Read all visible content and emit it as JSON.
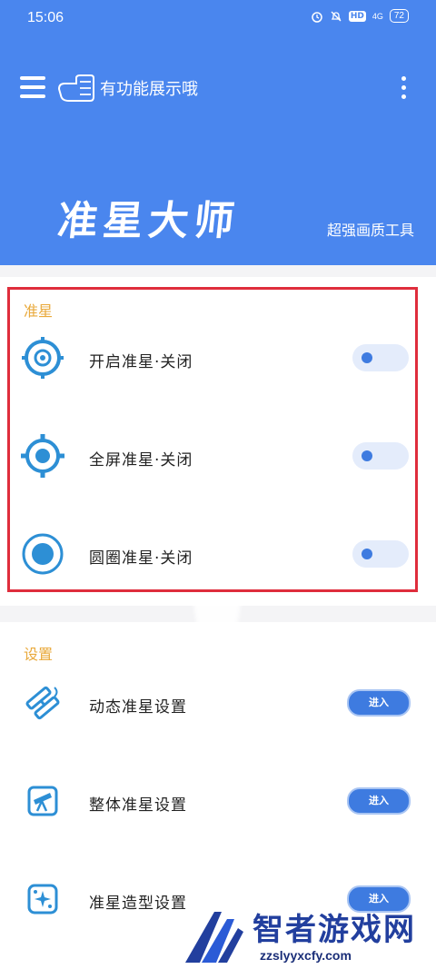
{
  "status_bar": {
    "time": "15:06",
    "network": "4G",
    "hd": "HD",
    "battery": "72"
  },
  "toolbar": {
    "title": "有功能展示哦"
  },
  "header": {
    "app_title": "准星大师",
    "subtitle": "超强画质工具"
  },
  "section_crosshair": {
    "title": "准星",
    "rows": [
      {
        "label": "开启准星·关闭",
        "icon": "crosshair-ring-icon",
        "toggle_on": false
      },
      {
        "label": "全屏准星·关闭",
        "icon": "crosshair-dot-icon",
        "toggle_on": false
      },
      {
        "label": "圆圈准星·关闭",
        "icon": "circle-target-icon",
        "toggle_on": false
      }
    ]
  },
  "section_settings": {
    "title": "设置",
    "rows": [
      {
        "label": "动态准星设置",
        "icon": "satellite-icon",
        "button": "进入"
      },
      {
        "label": "整体准星设置",
        "icon": "telescope-icon",
        "button": "进入"
      },
      {
        "label": "准星造型设置",
        "icon": "sparkle-icon",
        "button": "进入"
      }
    ]
  },
  "watermark": {
    "text": "智者游戏网",
    "url": "zzslyyxcfy.com"
  },
  "colors": {
    "primary": "#4a86ee",
    "accent": "#e9a93b",
    "highlight": "#df2d3c",
    "icon": "#2d8fd5"
  }
}
